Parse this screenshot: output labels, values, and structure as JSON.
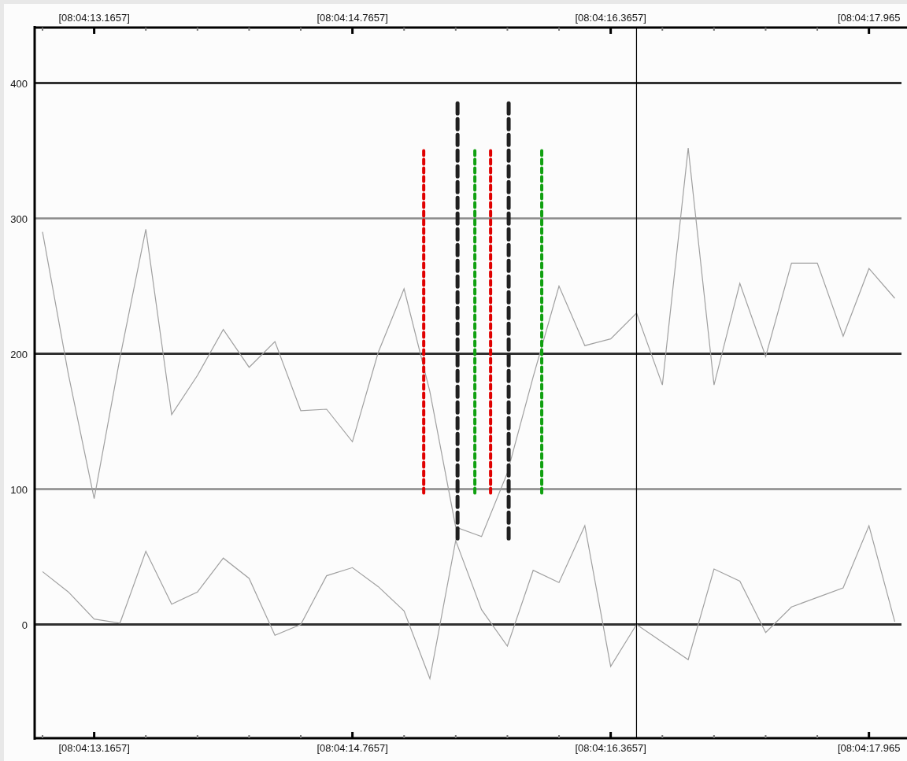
{
  "chart_data": {
    "type": "line",
    "categories": [
      null,
      null,
      "[08:04:13.1657]",
      null,
      null,
      null,
      null,
      null,
      null,
      null,
      null,
      null,
      "[08:04:14.7657]",
      null,
      null,
      null,
      null,
      null,
      null,
      null,
      null,
      null,
      "[08:04:16.3657]",
      null,
      null,
      null,
      null,
      null,
      null,
      null,
      null,
      null,
      "[08:04:17.965",
      null
    ],
    "series": [
      {
        "color": "#a0a0a0",
        "values": [
          290,
          185,
          93,
          197,
          292,
          155,
          184,
          218,
          190,
          209,
          158,
          159,
          135,
          201,
          248,
          172,
          72,
          65,
          112,
          183,
          250,
          206,
          211,
          230,
          177,
          352,
          177,
          252,
          198,
          267,
          267,
          213,
          263,
          241
        ]
      },
      {
        "color": "#a0a0a0",
        "values": [
          39,
          24,
          4,
          1,
          54,
          15,
          24,
          49,
          34,
          -8,
          0,
          36,
          42,
          28,
          10,
          -40,
          62,
          11,
          -16,
          40,
          31,
          73,
          -31,
          0,
          -13,
          -26,
          41,
          32,
          -6,
          13,
          20,
          27,
          73,
          2
        ]
      }
    ],
    "ylim": [
      -84,
      441
    ],
    "grid": true,
    "yticks": [
      0,
      100,
      200,
      300,
      400
    ]
  }
}
